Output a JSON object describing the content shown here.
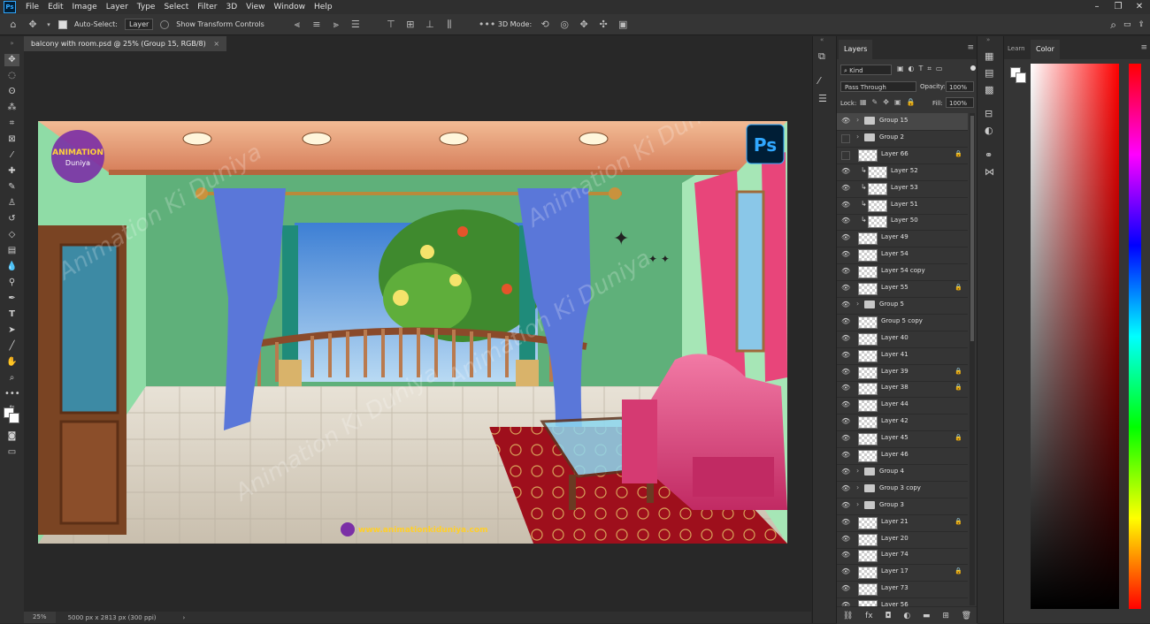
{
  "app": {
    "logo": "Ps"
  },
  "menu": [
    "File",
    "Edit",
    "Image",
    "Layer",
    "Type",
    "Select",
    "Filter",
    "3D",
    "View",
    "Window",
    "Help"
  ],
  "window_controls": [
    "minimize-icon",
    "restore-icon",
    "close-icon"
  ],
  "options_bar": {
    "auto_select_label": "Auto-Select:",
    "auto_select_value": "Layer",
    "show_transform_label": "Show Transform Controls",
    "mode_3d_label": "3D Mode:",
    "more": "•••"
  },
  "document_tab": {
    "title": "balcony with room.psd @ 25% (Group 15, RGB/8)",
    "close": "×"
  },
  "canvas": {
    "watermark": "Animation Ki Duniya",
    "logo_top": "ANIMATION",
    "logo_bottom": "Duniya",
    "ps_badge": "Ps",
    "website": "www.animationkiduniya.com",
    "colors": {
      "wall": "#5fb07a",
      "ceiling": "#e9a47d",
      "curtain_blue": "#5a77d9",
      "curtain_pink": "#e8457a",
      "sofa": "#e0437c",
      "rug": "#9e0f1c",
      "floor": "#cfc9bd"
    }
  },
  "status_bar": {
    "zoom": "25%",
    "doc_info": "5000 px x 2813 px (300 ppi)",
    "arrow": "›"
  },
  "layers_panel": {
    "tab": "Layers",
    "filter_kind": "Kind",
    "blend_mode": "Pass Through",
    "opacity_label": "Opacity:",
    "opacity_value": "100%",
    "lock_label": "Lock:",
    "fill_label": "Fill:",
    "fill_value": "100%",
    "layers": [
      {
        "name": "Group 15",
        "type": "group",
        "visible": true,
        "selected": true,
        "locked": false
      },
      {
        "name": "Group 2",
        "type": "group",
        "visible": false,
        "selected": false,
        "locked": false
      },
      {
        "name": "Layer 66",
        "type": "layer",
        "visible": false,
        "selected": false,
        "locked": true
      },
      {
        "name": "Layer 52",
        "type": "clip",
        "visible": true,
        "selected": false,
        "locked": false
      },
      {
        "name": "Layer 53",
        "type": "clip",
        "visible": true,
        "selected": false,
        "locked": false
      },
      {
        "name": "Layer 51",
        "type": "clip",
        "visible": true,
        "selected": false,
        "locked": false
      },
      {
        "name": "Layer 50",
        "type": "clip",
        "visible": true,
        "selected": false,
        "locked": false
      },
      {
        "name": "Layer 49",
        "type": "layer",
        "visible": true,
        "selected": false,
        "locked": false
      },
      {
        "name": "Layer 54",
        "type": "layer",
        "visible": true,
        "selected": false,
        "locked": false
      },
      {
        "name": "Layer 54 copy",
        "type": "layer",
        "visible": true,
        "selected": false,
        "locked": false
      },
      {
        "name": "Layer 55",
        "type": "layer",
        "visible": true,
        "selected": false,
        "locked": true
      },
      {
        "name": "Group 5",
        "type": "group",
        "visible": true,
        "selected": false,
        "locked": false
      },
      {
        "name": "Group 5 copy",
        "type": "layer",
        "visible": true,
        "selected": false,
        "locked": false
      },
      {
        "name": "Layer 40",
        "type": "layer",
        "visible": true,
        "selected": false,
        "locked": false
      },
      {
        "name": "Layer 41",
        "type": "layer",
        "visible": true,
        "selected": false,
        "locked": false
      },
      {
        "name": "Layer 39",
        "type": "layer",
        "visible": true,
        "selected": false,
        "locked": true
      },
      {
        "name": "Layer 38",
        "type": "layer",
        "visible": true,
        "selected": false,
        "locked": true
      },
      {
        "name": "Layer 44",
        "type": "layer",
        "visible": true,
        "selected": false,
        "locked": false
      },
      {
        "name": "Layer 42",
        "type": "layer",
        "visible": true,
        "selected": false,
        "locked": false
      },
      {
        "name": "Layer 45",
        "type": "layer",
        "visible": true,
        "selected": false,
        "locked": true
      },
      {
        "name": "Layer 46",
        "type": "layer",
        "visible": true,
        "selected": false,
        "locked": false
      },
      {
        "name": "Group 4",
        "type": "group",
        "visible": true,
        "selected": false,
        "locked": false
      },
      {
        "name": "Group 3 copy",
        "type": "group",
        "visible": true,
        "selected": false,
        "locked": false
      },
      {
        "name": "Group 3",
        "type": "group",
        "visible": true,
        "selected": false,
        "locked": false
      },
      {
        "name": "Layer 21",
        "type": "layer",
        "visible": true,
        "selected": false,
        "locked": true
      },
      {
        "name": "Layer 20",
        "type": "layer",
        "visible": true,
        "selected": false,
        "locked": false
      },
      {
        "name": "Layer 74",
        "type": "layer",
        "visible": true,
        "selected": false,
        "locked": false
      },
      {
        "name": "Layer 17",
        "type": "layer",
        "visible": true,
        "selected": false,
        "locked": true
      },
      {
        "name": "Layer 73",
        "type": "layer",
        "visible": true,
        "selected": false,
        "locked": false
      },
      {
        "name": "Layer 56",
        "type": "layer",
        "visible": true,
        "selected": false,
        "locked": false
      }
    ]
  },
  "color_panel": {
    "tabs": [
      "Learn",
      "Color"
    ],
    "active_tab": "Color",
    "hue_color": "#ff0000"
  }
}
